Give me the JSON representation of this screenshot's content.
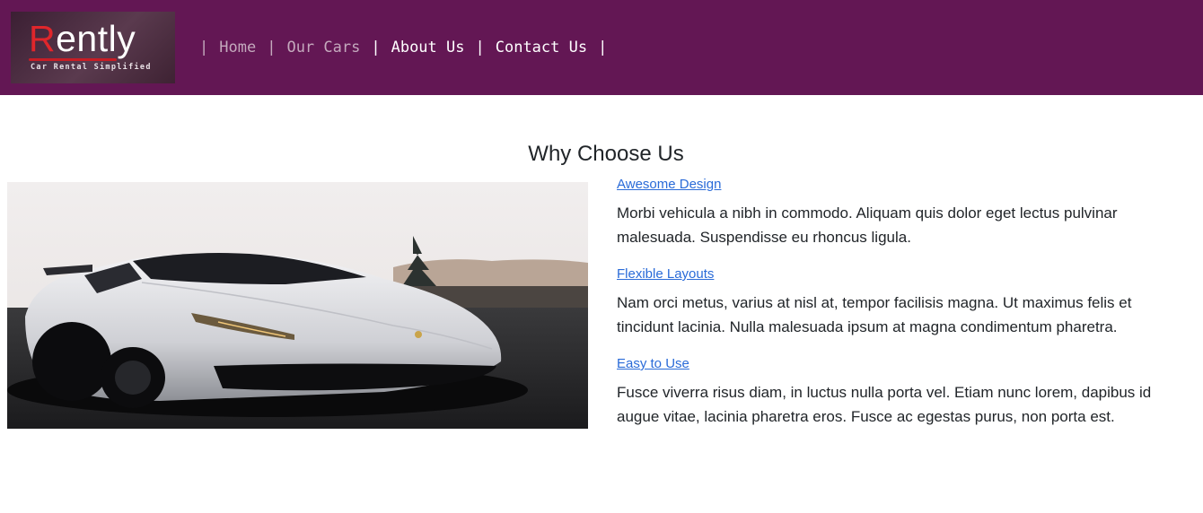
{
  "brand": {
    "name_initial": "R",
    "name_rest": "ently",
    "tagline": "Car Rental Simplified"
  },
  "nav": {
    "separator": "|",
    "items": [
      {
        "label": "Home"
      },
      {
        "label": "Our Cars"
      },
      {
        "label": "About Us",
        "active": true
      },
      {
        "label": "Contact Us"
      }
    ]
  },
  "section": {
    "title": "Why Choose Us"
  },
  "features": [
    {
      "title": "Awesome Design",
      "text": "Morbi vehicula a nibh in commodo. Aliquam quis dolor eget lectus pulvinar malesuada. Suspendisse eu rhoncus ligula."
    },
    {
      "title": "Flexible Layouts",
      "text": "Nam orci metus, varius at nisl at, tempor facilisis magna. Ut maximus felis et tincidunt lacinia. Nulla malesuada ipsum at magna condimentum pharetra."
    },
    {
      "title": "Easy to Use",
      "text": "Fusce viverra risus diam, in luctus nulla porta vel. Etiam nunc lorem, dapibus id augue vitae, lacinia pharetra eros. Fusce ac egestas purus, non porta est."
    }
  ],
  "colors": {
    "navbar_bg": "#631754",
    "link": "#2a6bd8",
    "text": "#212529",
    "logo_red": "#e0262b"
  }
}
